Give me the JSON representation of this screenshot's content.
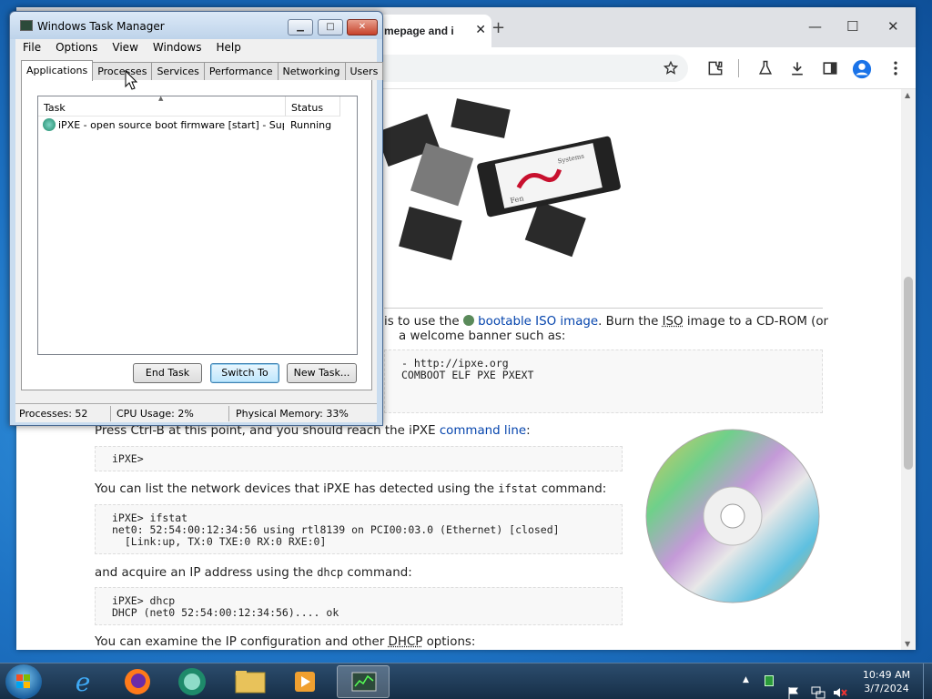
{
  "browser": {
    "tab_title": "mepage and i",
    "tab_close": "✕",
    "new_tab": "+",
    "win_min": "—",
    "win_max": "☐",
    "win_close": "✕"
  },
  "page": {
    "p1_a": "is to use the",
    "p1_link": "bootable ISO image",
    "p1_b": ". Burn the",
    "p1_iso": "ISO",
    "p1_c": "image to a CD-ROM (or",
    "p2": "a welcome banner such as:",
    "banner_lines": [
      "- http://ipxe.org",
      "COMBOOT ELF PXE PXEXT"
    ],
    "p3_a": "Press Ctrl-B at this point, and you should reach the iPXE",
    "p3_link": "command line",
    "p3_b": ":",
    "code1": [
      "iPXE>"
    ],
    "p4_a": "You can list the network devices that iPXE has detected using the",
    "p4_code": "ifstat",
    "p4_b": "command:",
    "code2": [
      "iPXE> ifstat",
      "net0: 52:54:00:12:34:56 using rtl8139 on PCI00:03.0 (Ethernet) [closed]",
      "  [Link:up, TX:0 TXE:0 RX:0 RXE:0]"
    ],
    "p5_a": "and acquire an IP address using the",
    "p5_code": "dhcp",
    "p5_b": "command:",
    "code3": [
      "iPXE> dhcp",
      "DHCP (net0 52:54:00:12:34:56).... ok"
    ],
    "p6_a": "You can examine the IP configuration and other",
    "p6_dhcp": "DHCP",
    "p6_b": "options:",
    "chip_brand_a": "Fen",
    "chip_brand_b": "Systems"
  },
  "taskmgr": {
    "title": "Windows Task Manager",
    "menu": [
      "File",
      "Options",
      "View",
      "Windows",
      "Help"
    ],
    "tabs": [
      "Applications",
      "Processes",
      "Services",
      "Performance",
      "Networking",
      "Users"
    ],
    "columns": [
      "Task",
      "Status"
    ],
    "rows": [
      {
        "task": "iPXE - open source boot firmware [start] - Super...",
        "status": "Running"
      }
    ],
    "buttons": {
      "end_task": "End Task",
      "switch_to": "Switch To",
      "new_task": "New Task..."
    },
    "status": {
      "processes": "Processes: 52",
      "cpu": "CPU Usage: 2%",
      "memory": "Physical Memory: 33%"
    }
  },
  "taskbar": {
    "time": "10:49 AM",
    "date": "3/7/2024"
  }
}
